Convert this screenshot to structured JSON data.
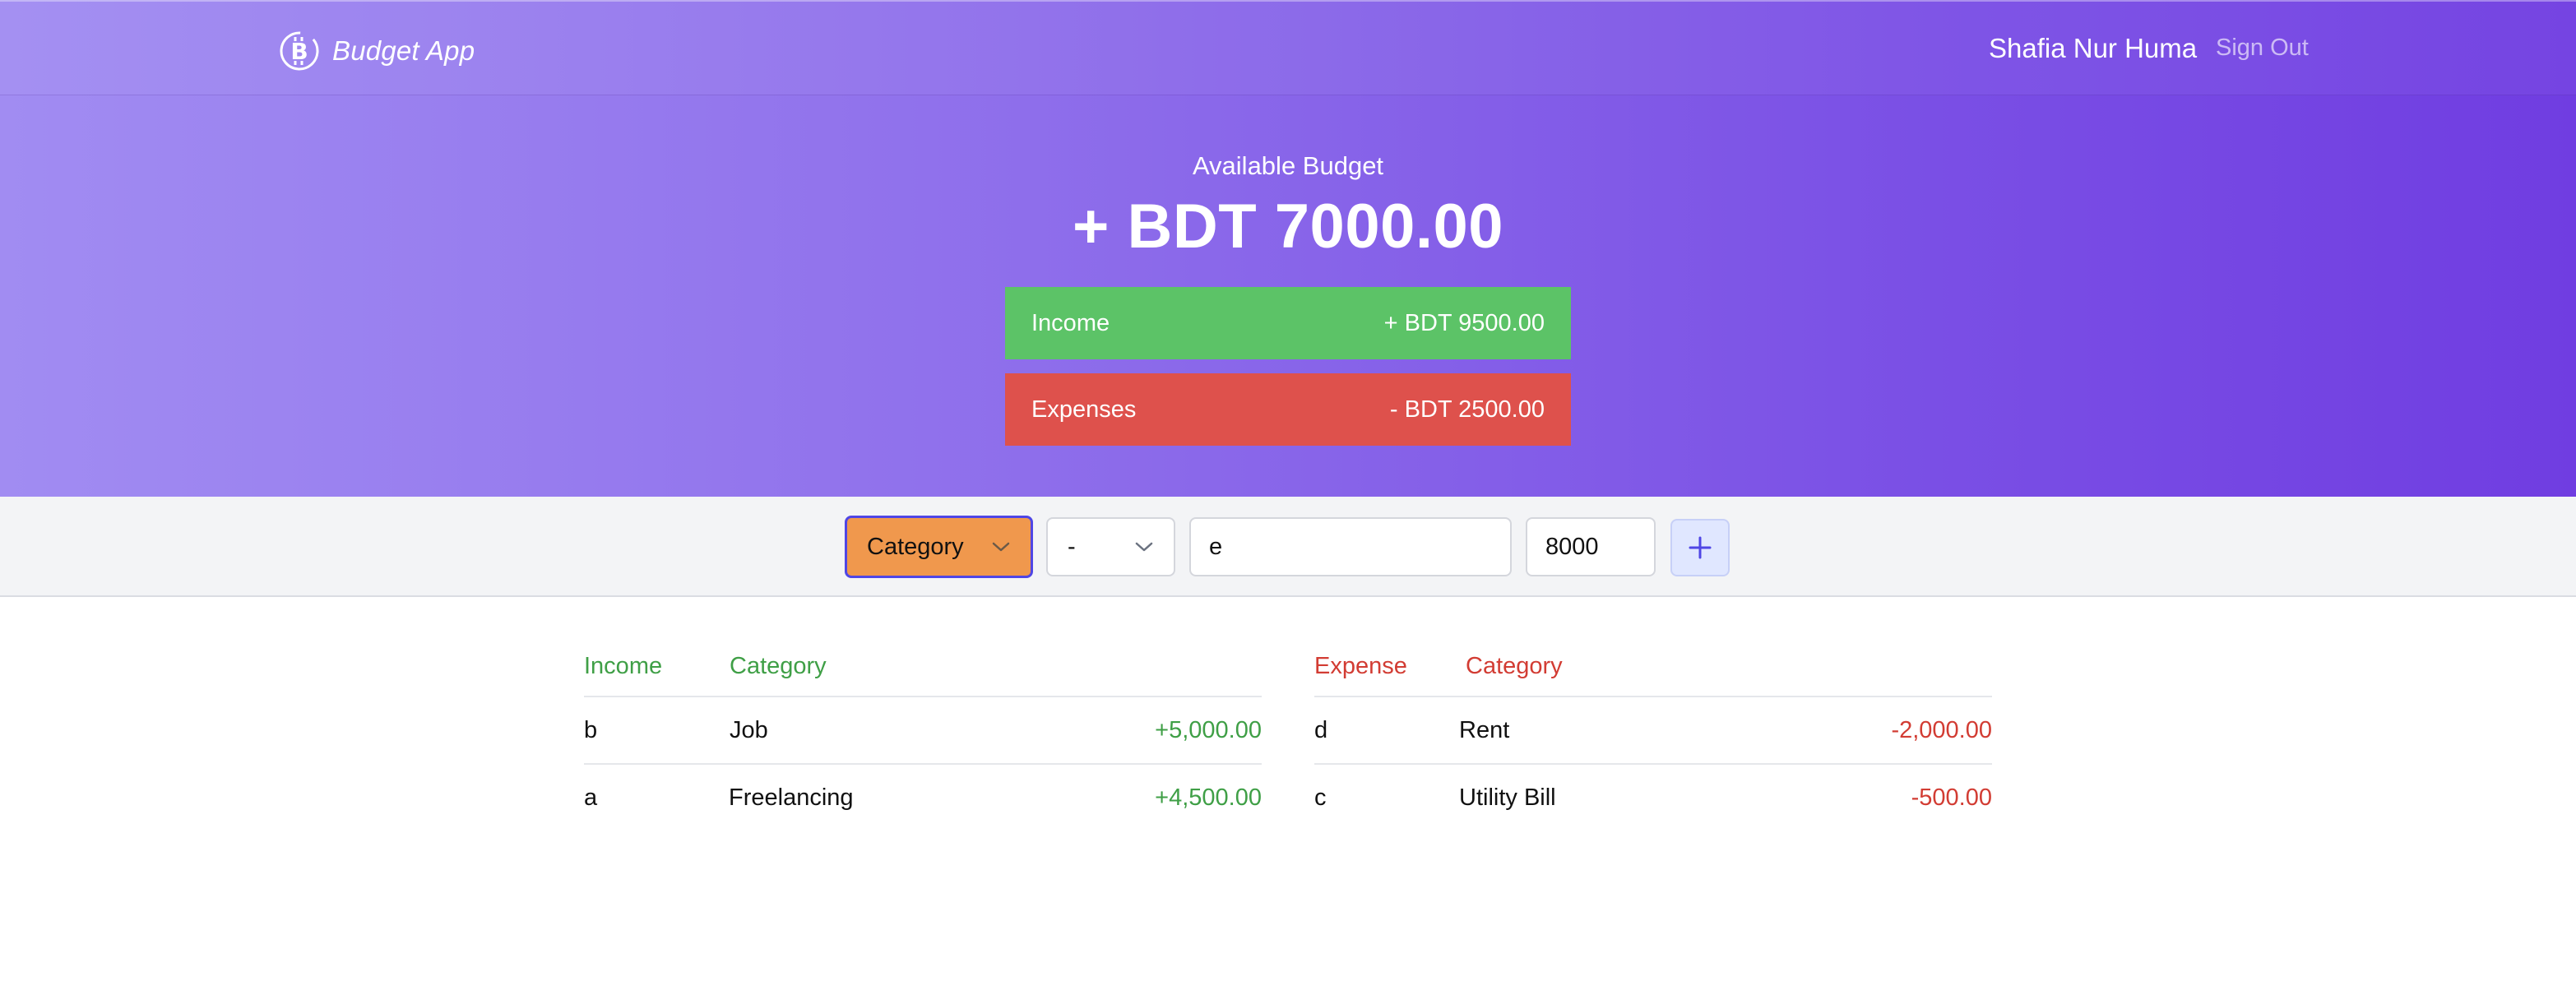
{
  "header": {
    "app_name": "Budget App",
    "user_name": "Shafia Nur Huma",
    "sign_out_label": "Sign Out"
  },
  "budget": {
    "label": "Available Budget",
    "value": "+ BDT 7000.00"
  },
  "summary": {
    "income_label": "Income",
    "income_value": "+ BDT 9500.00",
    "expense_label": "Expenses",
    "expense_value": "- BDT 2500.00"
  },
  "form": {
    "category_value": "Category",
    "sign_value": "-",
    "description_value": "e",
    "amount_value": "8000",
    "add_icon": "plus-icon"
  },
  "income_table": {
    "headers": [
      "Income",
      "Category"
    ],
    "rows": [
      {
        "name": "b",
        "category": "Job",
        "amount": "+5,000.00"
      },
      {
        "name": "a",
        "category": "Freelancing",
        "amount": "+4,500.00"
      }
    ]
  },
  "expense_table": {
    "headers": [
      "Expense",
      "Category"
    ],
    "rows": [
      {
        "name": "d",
        "category": "Rent",
        "amount": "-2,000.00"
      },
      {
        "name": "c",
        "category": "Utility Bill",
        "amount": "-500.00"
      }
    ]
  },
  "colors": {
    "hero_start": "#a18cf2",
    "hero_end": "#703de1",
    "income": "#5cc367",
    "expense": "#de514c",
    "category_select": "#f0984d",
    "focus_ring": "#4f46e5"
  }
}
